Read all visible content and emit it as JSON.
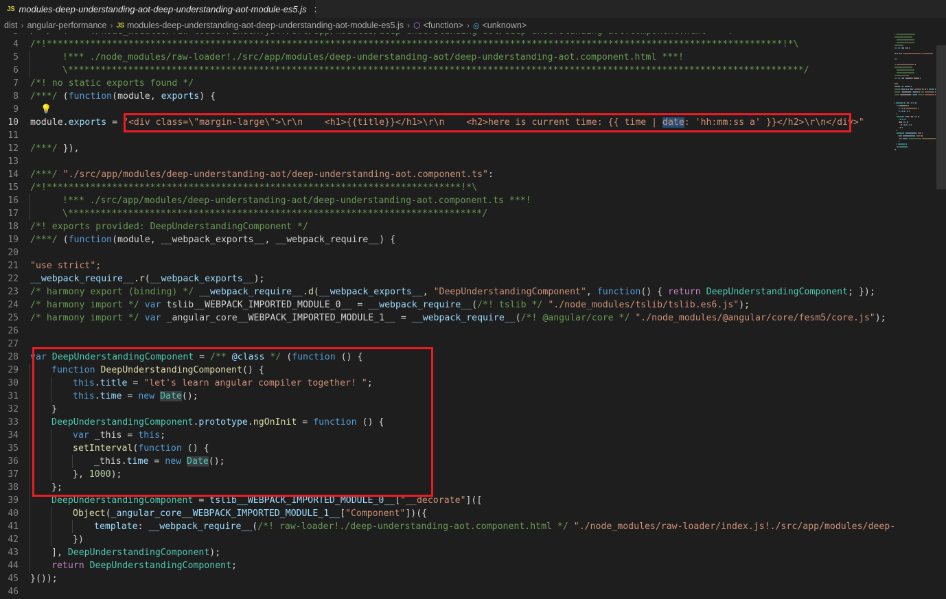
{
  "window": {
    "background": "#1e1e1e",
    "accent_red": "#ed1c24"
  },
  "tab": {
    "icon": "js-file-icon",
    "icon_label": "JS",
    "title": "modules-deep-understanding-aot-deep-understanding-aot-module-es5.js",
    "close_label": "✕"
  },
  "breadcrumbs": {
    "items": [
      {
        "label": "dist",
        "kind": "folder"
      },
      {
        "label": "angular-performance",
        "kind": "folder"
      },
      {
        "label": "modules-deep-understanding-aot-deep-understanding-aot-module-es5.js",
        "kind": "file",
        "icon_label": "JS"
      },
      {
        "label": "<function>",
        "kind": "symbol",
        "icon_label": "⬡"
      },
      {
        "label": "<unknown>",
        "kind": "symbol",
        "icon_label": "◎"
      }
    ],
    "separator": "›"
  },
  "editor": {
    "language": "javascript",
    "first_visible_line": 3,
    "last_visible_line": 46,
    "active_line": 10,
    "lightbulb_line": 9,
    "selection_text": "date",
    "word_highlight_text": "Date",
    "annotations": [
      {
        "name": "template-string-highlight",
        "lines": "10"
      },
      {
        "name": "component-class-highlight",
        "lines": "28-38"
      }
    ],
    "lines": [
      {
        "n": 3,
        "clipped": true,
        "tokens": [
          {
            "t": "/*",
            "c": "c-cmt"
          },
          {
            "t": "*/",
            "c": "c-cmt"
          },
          {
            "t": "  !*** ./node_modules/raw-loader/index.js!./src/app/modules/deep-understanding-aot/deep-understanding-aot.component.html ***!",
            "c": "c-cmt"
          }
        ]
      },
      {
        "n": 4,
        "indent": 0,
        "tokens": [
          {
            "t": "/*!***************************************************************************************************************************************!*\\",
            "c": "c-cmt"
          }
        ]
      },
      {
        "n": 5,
        "indent": 1,
        "tokens": [
          {
            "t": "  !*** ./node_modules/raw-loader!./src/app/modules/deep-understanding-aot/deep-understanding-aot.component.html ***!",
            "c": "c-cmt"
          }
        ]
      },
      {
        "n": 6,
        "indent": 1,
        "tokens": [
          {
            "t": "  \\***************************************************************************************************************************************/",
            "c": "c-cmt"
          }
        ]
      },
      {
        "n": 7,
        "indent": 0,
        "tokens": [
          {
            "t": "/*! no static exports found */",
            "c": "c-cmt"
          }
        ]
      },
      {
        "n": 8,
        "indent": 0,
        "tokens": [
          {
            "t": "/***/ ",
            "c": "c-cmt"
          },
          {
            "t": "(",
            "c": "c-punct"
          },
          {
            "t": "function",
            "c": "c-kw"
          },
          {
            "t": "(",
            "c": "c-punct"
          },
          {
            "t": "module",
            "c": "c-plain"
          },
          {
            "t": ", ",
            "c": "c-punct"
          },
          {
            "t": "exports",
            "c": "c-var"
          },
          {
            "t": ") {",
            "c": "c-punct"
          }
        ]
      },
      {
        "n": 9,
        "indent": 0,
        "lightbulb": true,
        "tokens": []
      },
      {
        "n": 10,
        "active": true,
        "indent": 0,
        "tokens": [
          {
            "t": "module",
            "c": "c-plain"
          },
          {
            "t": ".",
            "c": "c-punct"
          },
          {
            "t": "exports",
            "c": "c-var"
          },
          {
            "t": " = ",
            "c": "c-punct"
          },
          {
            "t": "\"<div class=\\\"margin-large\\\">\\r\\n    <h1>{{title}}</h1>\\r\\n    <h2>here is current time: {{ time | ",
            "c": "c-str"
          },
          {
            "t": "date",
            "c": "c-str",
            "sel": true
          },
          {
            "t": ": 'hh:mm:ss a' }}</h2>\\r\\n</div>\"",
            "c": "c-str"
          }
        ]
      },
      {
        "n": 11,
        "indent": 0,
        "tokens": []
      },
      {
        "n": 12,
        "indent": 0,
        "tokens": [
          {
            "t": "/***/ ",
            "c": "c-cmt"
          },
          {
            "t": "}),",
            "c": "c-punct"
          }
        ]
      },
      {
        "n": 13,
        "indent": 0,
        "tokens": []
      },
      {
        "n": 14,
        "indent": 0,
        "tokens": [
          {
            "t": "/***/ ",
            "c": "c-cmt"
          },
          {
            "t": "\"./src/app/modules/deep-understanding-aot/deep-understanding-aot.component.ts\"",
            "c": "c-str"
          },
          {
            "t": ":",
            "c": "c-punct"
          }
        ]
      },
      {
        "n": 15,
        "indent": 0,
        "tokens": [
          {
            "t": "/*!****************************************************************************!*\\",
            "c": "c-cmt"
          }
        ]
      },
      {
        "n": 16,
        "indent": 1,
        "tokens": [
          {
            "t": "  !*** ./src/app/modules/deep-understanding-aot/deep-understanding-aot.component.ts ***!",
            "c": "c-cmt"
          }
        ]
      },
      {
        "n": 17,
        "indent": 1,
        "tokens": [
          {
            "t": "  \\****************************************************************************/",
            "c": "c-cmt"
          }
        ]
      },
      {
        "n": 18,
        "indent": 0,
        "tokens": [
          {
            "t": "/*! exports provided: DeepUnderstandingComponent */",
            "c": "c-cmt"
          }
        ]
      },
      {
        "n": 19,
        "indent": 0,
        "tokens": [
          {
            "t": "/***/ ",
            "c": "c-cmt"
          },
          {
            "t": "(",
            "c": "c-punct"
          },
          {
            "t": "function",
            "c": "c-kw"
          },
          {
            "t": "(",
            "c": "c-punct"
          },
          {
            "t": "module",
            "c": "c-plain"
          },
          {
            "t": ", ",
            "c": "c-punct"
          },
          {
            "t": "__webpack_exports__",
            "c": "c-plain"
          },
          {
            "t": ", ",
            "c": "c-punct"
          },
          {
            "t": "__webpack_require__",
            "c": "c-plain"
          },
          {
            "t": ") {",
            "c": "c-punct"
          }
        ]
      },
      {
        "n": 20,
        "indent": 0,
        "tokens": []
      },
      {
        "n": 21,
        "indent": 0,
        "tokens": [
          {
            "t": "\"use strict\";",
            "c": "c-str"
          }
        ]
      },
      {
        "n": 22,
        "indent": 0,
        "tokens": [
          {
            "t": "__webpack_require__",
            "c": "c-var"
          },
          {
            "t": ".",
            "c": "c-punct"
          },
          {
            "t": "r",
            "c": "c-fn"
          },
          {
            "t": "(",
            "c": "c-punct"
          },
          {
            "t": "__webpack_exports__",
            "c": "c-var"
          },
          {
            "t": ");",
            "c": "c-punct"
          }
        ]
      },
      {
        "n": 23,
        "indent": 0,
        "tokens": [
          {
            "t": "/* harmony export (binding) */ ",
            "c": "c-cmt"
          },
          {
            "t": "__webpack_require__",
            "c": "c-var"
          },
          {
            "t": ".",
            "c": "c-punct"
          },
          {
            "t": "d",
            "c": "c-fn"
          },
          {
            "t": "(",
            "c": "c-punct"
          },
          {
            "t": "__webpack_exports__",
            "c": "c-var"
          },
          {
            "t": ", ",
            "c": "c-punct"
          },
          {
            "t": "\"DeepUnderstandingComponent\"",
            "c": "c-str"
          },
          {
            "t": ", ",
            "c": "c-punct"
          },
          {
            "t": "function",
            "c": "c-kw"
          },
          {
            "t": "() { ",
            "c": "c-punct"
          },
          {
            "t": "return",
            "c": "c-ctrl"
          },
          {
            "t": " DeepUnderstandingComponent",
            "c": "c-type"
          },
          {
            "t": "; });",
            "c": "c-punct"
          }
        ]
      },
      {
        "n": 24,
        "indent": 0,
        "tokens": [
          {
            "t": "/* harmony import */ ",
            "c": "c-cmt"
          },
          {
            "t": "var",
            "c": "c-kw"
          },
          {
            "t": " tslib__WEBPACK_IMPORTED_MODULE_0__",
            "c": "c-plain"
          },
          {
            "t": " = ",
            "c": "c-punct"
          },
          {
            "t": "__webpack_require__",
            "c": "c-var"
          },
          {
            "t": "(",
            "c": "c-punct"
          },
          {
            "t": "/*! tslib */",
            "c": "c-cmt"
          },
          {
            "t": " ",
            "c": "c-punct"
          },
          {
            "t": "\"./node_modules/tslib/tslib.es6.js\"",
            "c": "c-str"
          },
          {
            "t": ");",
            "c": "c-punct"
          }
        ]
      },
      {
        "n": 25,
        "indent": 0,
        "tokens": [
          {
            "t": "/* harmony import */ ",
            "c": "c-cmt"
          },
          {
            "t": "var",
            "c": "c-kw"
          },
          {
            "t": " _angular_core__WEBPACK_IMPORTED_MODULE_1__",
            "c": "c-plain"
          },
          {
            "t": " = ",
            "c": "c-punct"
          },
          {
            "t": "__webpack_require__",
            "c": "c-var"
          },
          {
            "t": "(",
            "c": "c-punct"
          },
          {
            "t": "/*! @angular/core */",
            "c": "c-cmt"
          },
          {
            "t": " ",
            "c": "c-punct"
          },
          {
            "t": "\"./node_modules/@angular/core/fesm5/core.js\"",
            "c": "c-str"
          },
          {
            "t": ");",
            "c": "c-punct"
          }
        ]
      },
      {
        "n": 26,
        "indent": 0,
        "tokens": []
      },
      {
        "n": 27,
        "indent": 0,
        "tokens": []
      },
      {
        "n": 28,
        "indent": 0,
        "tokens": [
          {
            "t": "var",
            "c": "c-kw"
          },
          {
            "t": " DeepUnderstandingComponent",
            "c": "c-type"
          },
          {
            "t": " = ",
            "c": "c-punct"
          },
          {
            "t": "/** ",
            "c": "c-cmt"
          },
          {
            "t": "@class",
            "c": "c-var"
          },
          {
            "t": " */",
            "c": "c-cmt"
          },
          {
            "t": " (",
            "c": "c-punct"
          },
          {
            "t": "function",
            "c": "c-kw"
          },
          {
            "t": " () {",
            "c": "c-punct"
          }
        ]
      },
      {
        "n": 29,
        "indent": 1,
        "tokens": [
          {
            "t": "function",
            "c": "c-kw"
          },
          {
            "t": " ",
            "c": "c-punct"
          },
          {
            "t": "DeepUnderstandingComponent",
            "c": "c-fn"
          },
          {
            "t": "() {",
            "c": "c-punct"
          }
        ]
      },
      {
        "n": 30,
        "indent": 2,
        "tokens": [
          {
            "t": "this",
            "c": "c-kw"
          },
          {
            "t": ".",
            "c": "c-punct"
          },
          {
            "t": "title",
            "c": "c-var"
          },
          {
            "t": " = ",
            "c": "c-punct"
          },
          {
            "t": "\"let's learn angular compiler together! \"",
            "c": "c-str"
          },
          {
            "t": ";",
            "c": "c-punct"
          }
        ]
      },
      {
        "n": 31,
        "indent": 2,
        "tokens": [
          {
            "t": "this",
            "c": "c-kw"
          },
          {
            "t": ".",
            "c": "c-punct"
          },
          {
            "t": "time",
            "c": "c-var"
          },
          {
            "t": " = ",
            "c": "c-punct"
          },
          {
            "t": "new",
            "c": "c-kw"
          },
          {
            "t": " ",
            "c": "c-punct"
          },
          {
            "t": "Date",
            "c": "c-type",
            "hl": true
          },
          {
            "t": "();",
            "c": "c-punct"
          }
        ]
      },
      {
        "n": 32,
        "indent": 1,
        "tokens": [
          {
            "t": "}",
            "c": "c-punct"
          }
        ]
      },
      {
        "n": 33,
        "indent": 1,
        "tokens": [
          {
            "t": "DeepUnderstandingComponent",
            "c": "c-type"
          },
          {
            "t": ".",
            "c": "c-punct"
          },
          {
            "t": "prototype",
            "c": "c-var"
          },
          {
            "t": ".",
            "c": "c-punct"
          },
          {
            "t": "ngOnInit",
            "c": "c-fn"
          },
          {
            "t": " = ",
            "c": "c-punct"
          },
          {
            "t": "function",
            "c": "c-kw"
          },
          {
            "t": " () {",
            "c": "c-punct"
          }
        ]
      },
      {
        "n": 34,
        "indent": 2,
        "tokens": [
          {
            "t": "var",
            "c": "c-kw"
          },
          {
            "t": " _this",
            "c": "c-plain"
          },
          {
            "t": " = ",
            "c": "c-punct"
          },
          {
            "t": "this",
            "c": "c-kw"
          },
          {
            "t": ";",
            "c": "c-punct"
          }
        ]
      },
      {
        "n": 35,
        "indent": 2,
        "tokens": [
          {
            "t": "setInterval",
            "c": "c-fn"
          },
          {
            "t": "(",
            "c": "c-punct"
          },
          {
            "t": "function",
            "c": "c-kw"
          },
          {
            "t": " () {",
            "c": "c-punct"
          }
        ]
      },
      {
        "n": 36,
        "indent": 3,
        "tokens": [
          {
            "t": "_this",
            "c": "c-plain"
          },
          {
            "t": ".",
            "c": "c-punct"
          },
          {
            "t": "time",
            "c": "c-var"
          },
          {
            "t": " = ",
            "c": "c-punct"
          },
          {
            "t": "new",
            "c": "c-kw"
          },
          {
            "t": " ",
            "c": "c-punct"
          },
          {
            "t": "Date",
            "c": "c-type",
            "hl": true
          },
          {
            "t": "();",
            "c": "c-punct"
          }
        ]
      },
      {
        "n": 37,
        "indent": 2,
        "tokens": [
          {
            "t": "}, ",
            "c": "c-punct"
          },
          {
            "t": "1000",
            "c": "c-num"
          },
          {
            "t": ");",
            "c": "c-punct"
          }
        ]
      },
      {
        "n": 38,
        "indent": 1,
        "tokens": [
          {
            "t": "};",
            "c": "c-punct"
          }
        ]
      },
      {
        "n": 39,
        "indent": 1,
        "tokens": [
          {
            "t": "DeepUnderstandingComponent",
            "c": "c-type"
          },
          {
            "t": " = ",
            "c": "c-punct"
          },
          {
            "t": "tslib__WEBPACK_IMPORTED_MODULE_0__",
            "c": "c-var"
          },
          {
            "t": "[",
            "c": "c-punct"
          },
          {
            "t": "\"__decorate\"",
            "c": "c-str"
          },
          {
            "t": "]([",
            "c": "c-punct"
          }
        ]
      },
      {
        "n": 40,
        "indent": 2,
        "tokens": [
          {
            "t": "Object",
            "c": "c-fn"
          },
          {
            "t": "(",
            "c": "c-punct"
          },
          {
            "t": "_angular_core__WEBPACK_IMPORTED_MODULE_1__",
            "c": "c-var"
          },
          {
            "t": "[",
            "c": "c-punct"
          },
          {
            "t": "\"Component\"",
            "c": "c-str"
          },
          {
            "t": "])({",
            "c": "c-punct"
          }
        ]
      },
      {
        "n": 41,
        "indent": 3,
        "tokens": [
          {
            "t": "template",
            "c": "c-var"
          },
          {
            "t": ": ",
            "c": "c-punct"
          },
          {
            "t": "__webpack_require__",
            "c": "c-var"
          },
          {
            "t": "(",
            "c": "c-punct"
          },
          {
            "t": "/*! raw-loader!./deep-understanding-aot.component.html */",
            "c": "c-cmt"
          },
          {
            "t": " ",
            "c": "c-punct"
          },
          {
            "t": "\"./node_modules/raw-loader/index.js!./src/app/modules/deep-understandin",
            "c": "c-str"
          }
        ]
      },
      {
        "n": 42,
        "indent": 2,
        "tokens": [
          {
            "t": "})",
            "c": "c-punct"
          }
        ]
      },
      {
        "n": 43,
        "indent": 1,
        "tokens": [
          {
            "t": "], ",
            "c": "c-punct"
          },
          {
            "t": "DeepUnderstandingComponent",
            "c": "c-type"
          },
          {
            "t": ");",
            "c": "c-punct"
          }
        ]
      },
      {
        "n": 44,
        "indent": 1,
        "tokens": [
          {
            "t": "return",
            "c": "c-ctrl"
          },
          {
            "t": " DeepUnderstandingComponent",
            "c": "c-type"
          },
          {
            "t": ";",
            "c": "c-punct"
          }
        ]
      },
      {
        "n": 45,
        "indent": 0,
        "tokens": [
          {
            "t": "}());",
            "c": "c-punct"
          }
        ]
      },
      {
        "n": 46,
        "indent": 0,
        "tokens": []
      }
    ]
  }
}
